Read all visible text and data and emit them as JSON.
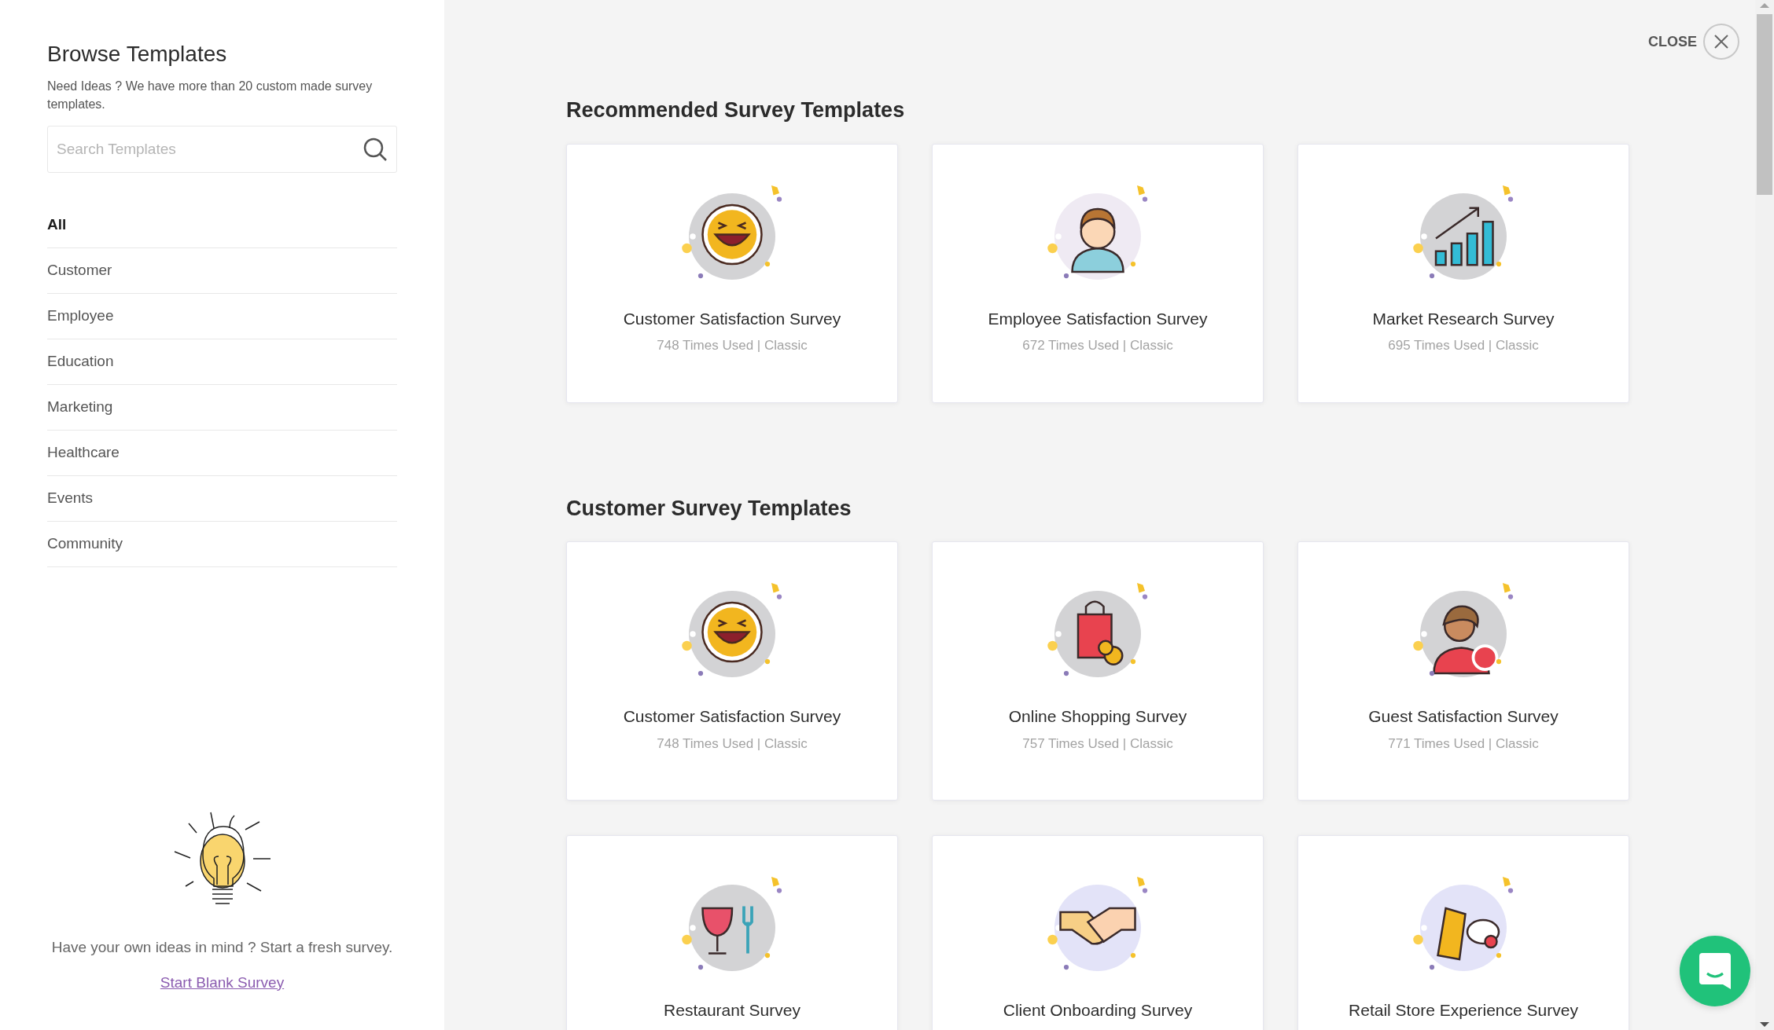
{
  "sidebar": {
    "title": "Browse Templates",
    "subtitle": "Need Ideas ? We have more than 20 custom made survey templates.",
    "search": {
      "placeholder": "Search Templates"
    },
    "categories": [
      {
        "label": "All",
        "selected": true
      },
      {
        "label": "Customer",
        "selected": false
      },
      {
        "label": "Employee",
        "selected": false
      },
      {
        "label": "Education",
        "selected": false
      },
      {
        "label": "Marketing",
        "selected": false
      },
      {
        "label": "Healthcare",
        "selected": false
      },
      {
        "label": "Events",
        "selected": false
      },
      {
        "label": "Community",
        "selected": false
      }
    ],
    "prompt": "Have your own ideas in mind ? Start a fresh survey.",
    "link": "Start Blank Survey"
  },
  "close_label": "CLOSE",
  "sections": [
    {
      "heading": "Recommended Survey Templates",
      "templates": [
        {
          "kind": "laughing-face",
          "title": "Customer Satisfaction Survey",
          "meta": "748 Times Used | Classic"
        },
        {
          "kind": "person",
          "title": "Employee Satisfaction Survey",
          "meta": "672 Times Used | Classic"
        },
        {
          "kind": "chart",
          "title": "Market Research Survey",
          "meta": "695 Times Used | Classic"
        }
      ]
    },
    {
      "heading": "Customer Survey Templates",
      "templates": [
        {
          "kind": "laughing-face",
          "title": "Customer Satisfaction Survey",
          "meta": "748 Times Used | Classic"
        },
        {
          "kind": "bag",
          "title": "Online Shopping Survey",
          "meta": "757 Times Used | Classic"
        },
        {
          "kind": "guest",
          "title": "Guest Satisfaction Survey",
          "meta": "771 Times Used | Classic"
        },
        {
          "kind": "dining",
          "title": "Restaurant Survey"
        },
        {
          "kind": "handshake",
          "title": "Client Onboarding Survey"
        },
        {
          "kind": "tag",
          "title": "Retail Store Experience Survey"
        }
      ]
    }
  ]
}
